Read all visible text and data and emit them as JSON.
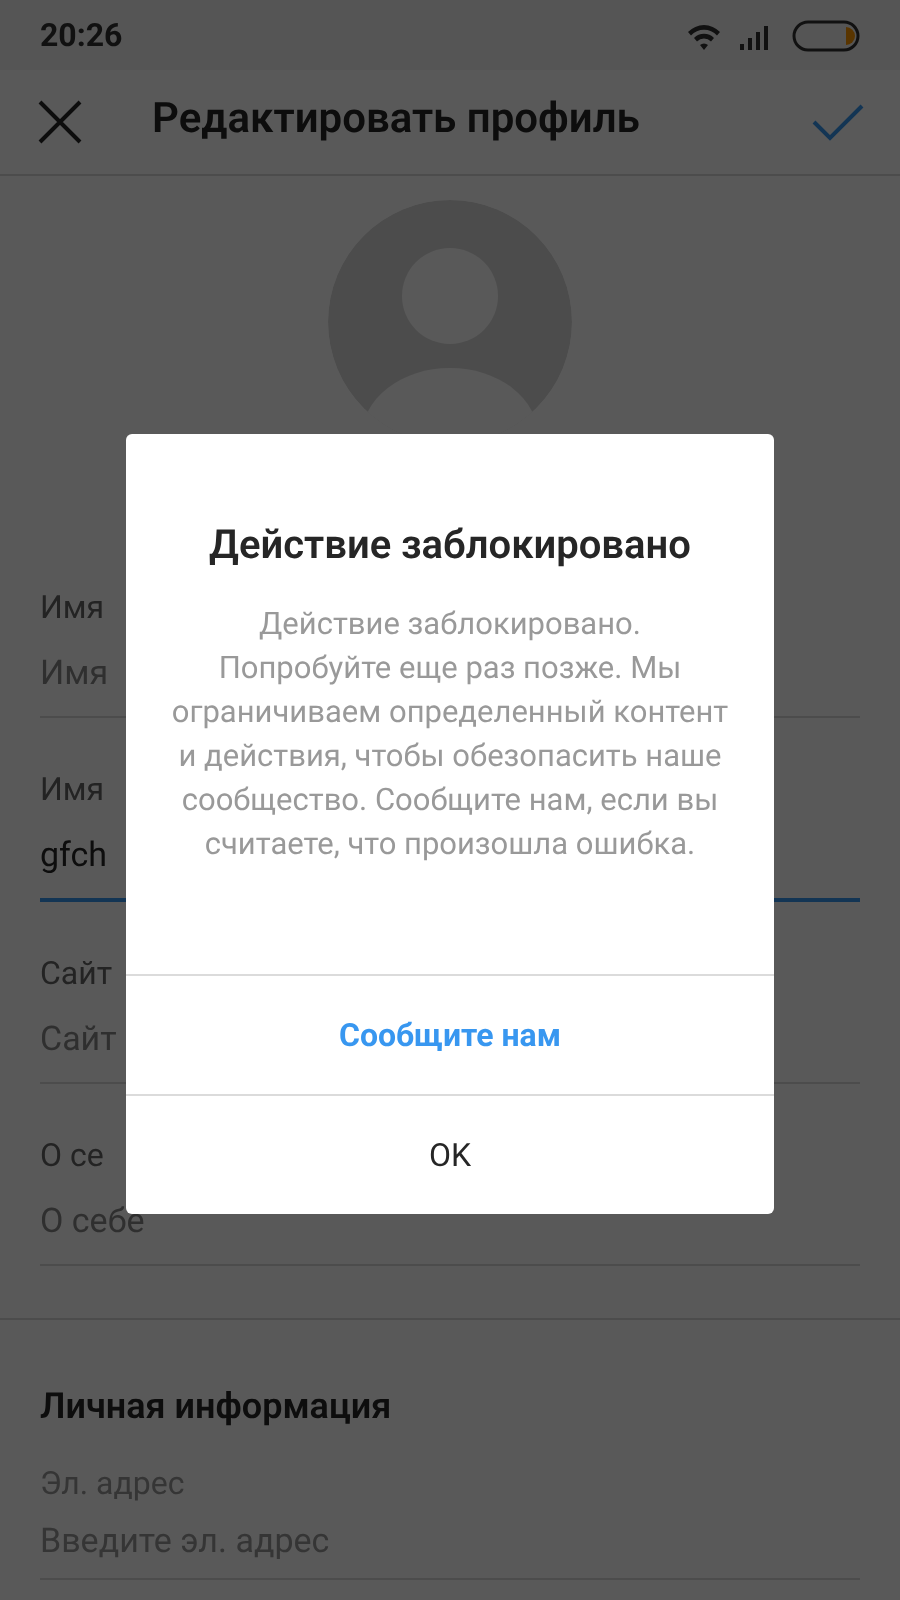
{
  "status_bar": {
    "time": "20:26"
  },
  "header": {
    "title": "Редактировать профиль"
  },
  "fields": [
    {
      "label": "Имя",
      "placeholder": "Имя",
      "focused": false
    },
    {
      "label": "Имя",
      "value": "gfch",
      "focused": true
    },
    {
      "label": "Сайт",
      "placeholder": "Сайт",
      "focused": false
    },
    {
      "label": "О се",
      "placeholder": "О себе",
      "focused": false
    }
  ],
  "personal": {
    "title": "Личная информация",
    "fields": [
      {
        "label": "Эл. адрес",
        "placeholder": "Введите эл. адрес"
      }
    ]
  },
  "dialog": {
    "title": "Действие заблокировано",
    "message": "Действие заблокировано. Попробуйте еще раз позже. Мы ограничиваем определенный контент и действия, чтобы обезопасить наше сообщество. Сообщите нам, если вы считаете, что произошла ошибка.",
    "buttons": [
      {
        "label": "Сообщите нам",
        "kind": "primary"
      },
      {
        "label": "OK",
        "kind": "plain"
      }
    ]
  }
}
